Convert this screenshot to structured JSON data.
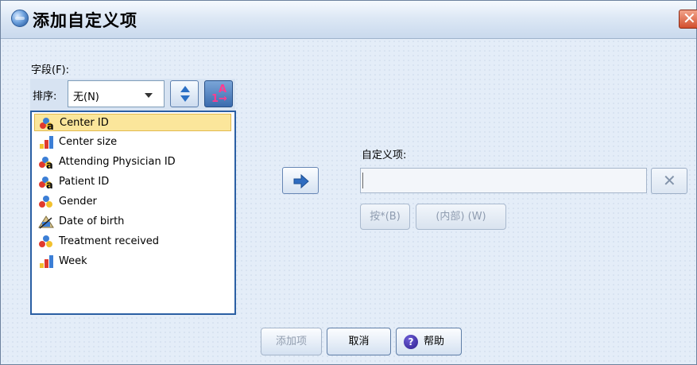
{
  "window": {
    "title": "添加自定义项",
    "close_icon": "close-icon"
  },
  "fields": {
    "label": "字段(F):",
    "sort_label": "排序:",
    "sort_value": "无(N)",
    "items": [
      {
        "label": "Center ID",
        "icon": "nominal-string-icon",
        "selected": true
      },
      {
        "label": "Center size",
        "icon": "scale-bar-icon"
      },
      {
        "label": "Attending Physician ID",
        "icon": "nominal-string-icon"
      },
      {
        "label": "Patient ID",
        "icon": "nominal-string-icon"
      },
      {
        "label": "Gender",
        "icon": "nominal-icon"
      },
      {
        "label": "Date of birth",
        "icon": "date-icon"
      },
      {
        "label": "Treatment received",
        "icon": "nominal-icon"
      },
      {
        "label": "Week",
        "icon": "scale-bar-icon"
      }
    ]
  },
  "custom": {
    "label": "自定义项:",
    "value": "",
    "by_button": "按*(B)",
    "within_button": "(内部) (W)"
  },
  "buttons": {
    "add": "添加项",
    "cancel": "取消",
    "help": "帮助"
  },
  "colors": {
    "selection": "#fbe69b",
    "listbox_border": "#2b5fa3",
    "close_red": "#d24f2f"
  }
}
